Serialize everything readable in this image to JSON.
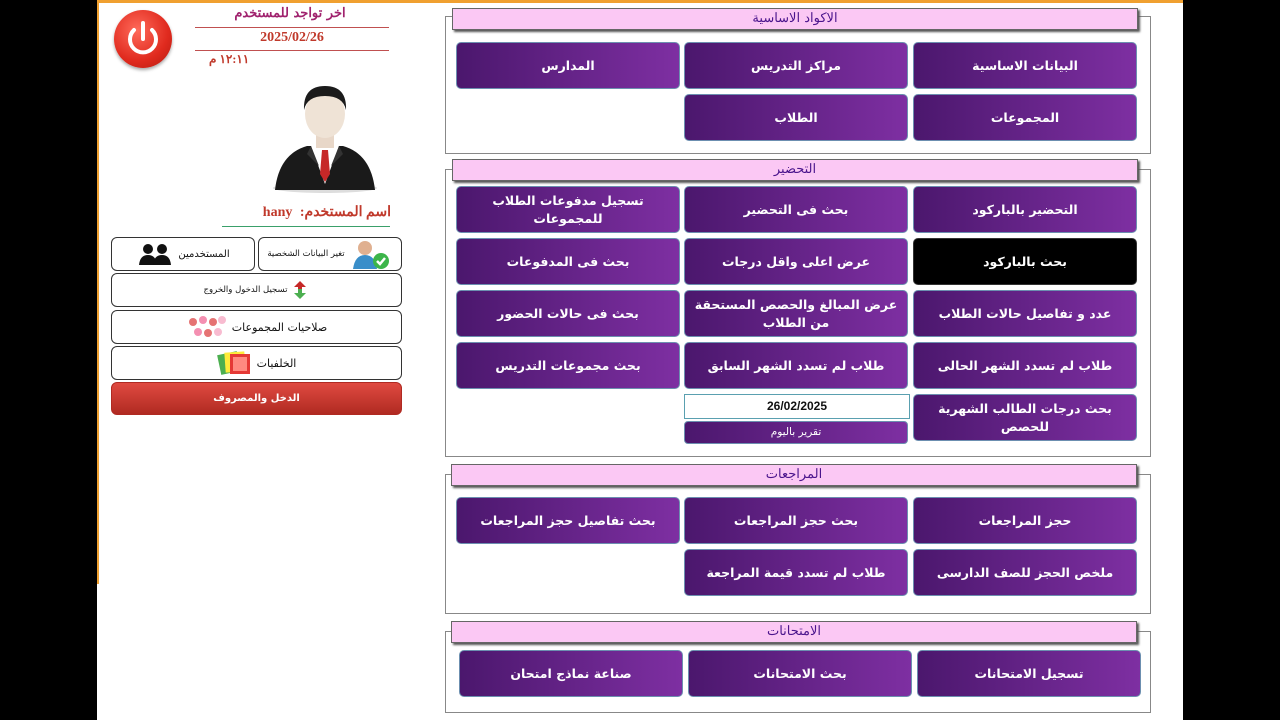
{
  "user_panel": {
    "last_seen_label": "اخر تواجد للمستخدم",
    "last_seen_date": "2025/02/26",
    "last_seen_time": "١٢:١١ م",
    "username_label": "اسم المستخدم:",
    "username_value": "hany",
    "buttons": {
      "change_profile": "تغير البيانات الشخصية",
      "users": "المستخدمين",
      "login_logout_log": "تسجيل الدخول والخروج",
      "group_permissions": "صلاحيات المجموعات",
      "backgrounds": "الخلفيات",
      "income_expense": "الدخل والمصروف"
    }
  },
  "sections": {
    "basic_codes": {
      "title": "الاكواد الاساسية",
      "buttons": [
        "البيانات الاساسية",
        "مراكز التدريس",
        "المدارس",
        "المجموعات",
        "الطلاب"
      ]
    },
    "attendance": {
      "title": "التحضير",
      "buttons": [
        "التحضير بالباركود",
        "بحث فى التحضير",
        "تسجيل مدفوعات الطلاب للمجموعات",
        "بحث بالباركود",
        "عرض اعلى واقل درجات",
        "بحث فى المدفوعات",
        "عدد و تفاصيل حالات الطلاب",
        "عرض المبالغ والحصص المستحقة من الطلاب",
        "بحث فى حالات الحضور",
        "طلاب لم تسدد الشهر الحالى",
        "طلاب لم تسدد الشهر السابق",
        "بحث مجموعات التدريس",
        "بحث درجات الطالب الشهرية للحصص"
      ],
      "report_date": "26/02/2025",
      "daily_report": "تقرير باليوم"
    },
    "reviews": {
      "title": "المراجعات",
      "buttons": [
        "حجز المراجعات",
        "بحث حجز المراجعات",
        "بحث تفاصيل حجز المراجعات",
        "ملخص الحجز للصف الدارسى",
        "طلاب لم تسدد قيمة المراجعة"
      ]
    },
    "exams": {
      "title": "الامتحانات",
      "buttons": [
        "تسجيل الامتحانات",
        "بحث الامتحانات",
        "صناعة نماذج امتحان"
      ]
    }
  },
  "colors": {
    "button_gradient_start": "#4b176d",
    "button_gradient_end": "#7e2fa2",
    "section_title_bg": "#fbc8f4",
    "accent_red": "#c0392b"
  }
}
